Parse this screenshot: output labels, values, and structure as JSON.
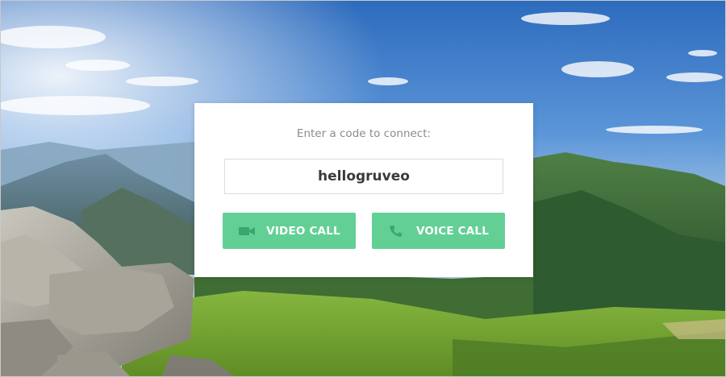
{
  "connect": {
    "prompt": "Enter a code to connect:",
    "code_value": "hellogruveo"
  },
  "buttons": {
    "video_call": {
      "label": "VIDEO CALL",
      "icon": "video-camera-icon"
    },
    "voice_call": {
      "label": "VOICE CALL",
      "icon": "phone-icon"
    }
  },
  "colors": {
    "button_bg": "#62d095",
    "button_icon": "#3aa86e",
    "card_bg": "#ffffff",
    "prompt_text": "#8b8b8b",
    "code_text": "#3a3a3a"
  },
  "background": {
    "description_icon": "mountain-landscape-image"
  }
}
